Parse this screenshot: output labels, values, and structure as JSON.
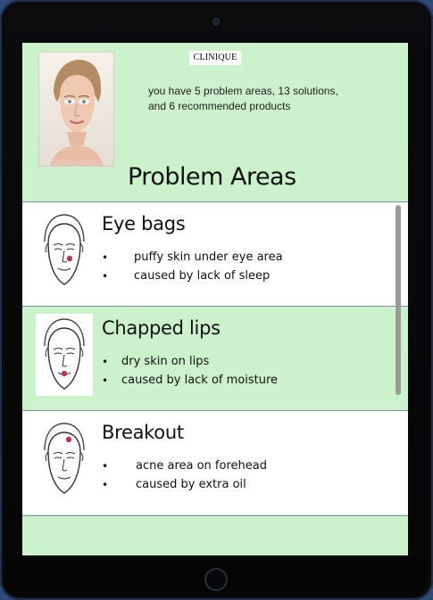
{
  "header": {
    "brand_logo_text": "CLINIQUE",
    "summary_line_1": "you have 5 problem areas, 13 solutions,",
    "summary_line_2": "and 6 recommended  products",
    "title": "Problem Areas"
  },
  "problem_areas": [
    {
      "title": "Eye bags",
      "bullets": [
        "puffy skin under  eye area",
        "caused by lack of sleep"
      ],
      "marker": "under-eye"
    },
    {
      "title": "Chapped lips",
      "bullets": [
        "dry skin on lips",
        "caused by lack of moisture"
      ],
      "marker": "lips"
    },
    {
      "title": "Breakout",
      "bullets": [
        "acne area on forehead",
        "caused by extra oil"
      ],
      "marker": "forehead"
    }
  ],
  "icons": {
    "bullet_glyph": "•",
    "face_icon": "face-diagram-icon",
    "portrait_icon": "user-portrait-photo"
  },
  "colors": {
    "screen_green": "#ccf2cc",
    "divider": "#7d8fb3",
    "marker_red": "#b63b4a"
  }
}
